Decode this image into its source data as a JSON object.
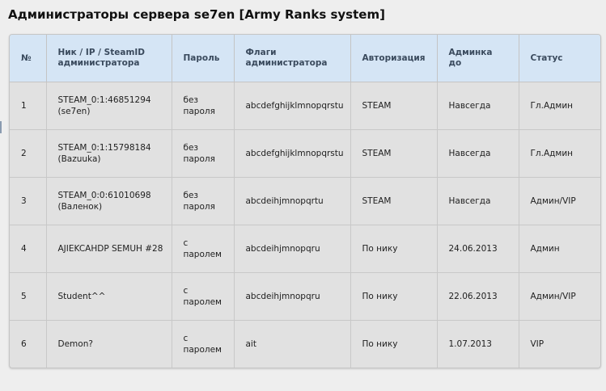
{
  "page": {
    "title": "Администраторы сервера se7en [Army Ranks system]"
  },
  "table": {
    "columns": [
      "№",
      "Ник / IP / SteamID\nадминистратора",
      "Пароль",
      "Флаги\nадминистратора",
      "Авторизация",
      "Админка\nдо",
      "Статус"
    ],
    "rows": [
      [
        "1",
        "STEAM_0:1:46851294\n(se7en)",
        "без\nпароля",
        "abcdefghijklmnopqrstu",
        "STEAM",
        "Навсегда",
        "Гл.Админ"
      ],
      [
        "2",
        "STEAM_0:1:15798184\n(Bazuuka)",
        "без\nпароля",
        "abcdefghijklmnopqrstu",
        "STEAM",
        "Навсегда",
        "Гл.Админ"
      ],
      [
        "3",
        "STEAM_0:0:61010698\n(Валенок)",
        "без\nпароля",
        "abcdeihjmnopqrtu",
        "STEAM",
        "Навсегда",
        "Админ/VIP"
      ],
      [
        "4",
        "AJIEKCAHDP SEMUH #28",
        "с\nпаролем",
        "abcdeihjmnopqru",
        "По нику",
        "24.06.2013",
        "Админ"
      ],
      [
        "5",
        "Student^^",
        "с\nпаролем",
        "abcdeihjmnopqru",
        "По нику",
        "22.06.2013",
        "Админ/VIP"
      ],
      [
        "6",
        "Demon?",
        "с\nпаролем",
        "ait",
        "По нику",
        "1.07.2013",
        "VIP"
      ]
    ]
  },
  "colors": {
    "header_bg": "#d5e5f5",
    "header_text": "#3a4a5d",
    "row_bg": "#e1e1e1",
    "page_bg": "#eeeeee"
  }
}
